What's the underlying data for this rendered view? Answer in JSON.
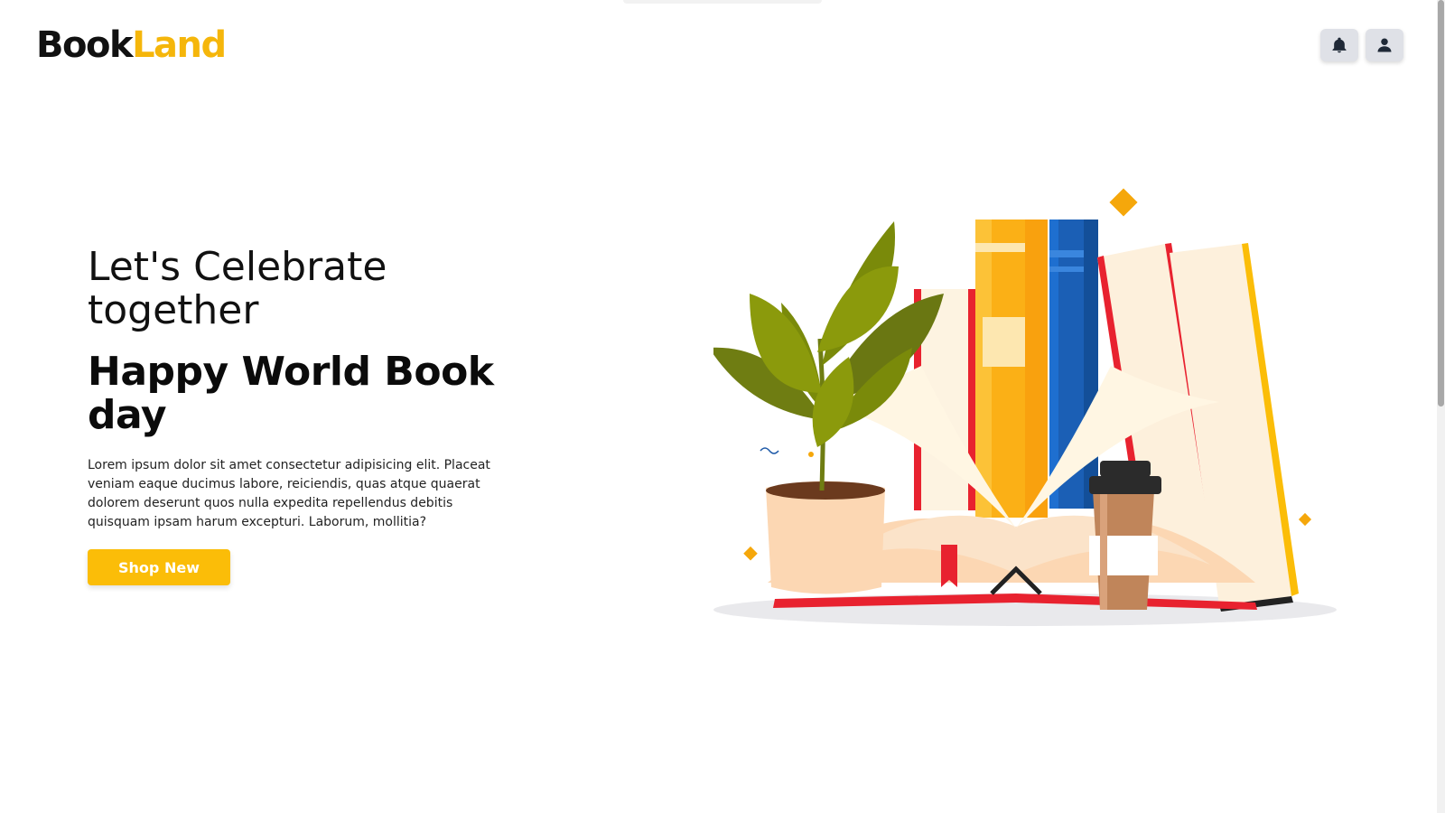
{
  "brand": {
    "part1": "Book",
    "part2": "Land",
    "colors": {
      "dark": "#111111",
      "accent": "#f5b60b"
    }
  },
  "header": {
    "notifications_icon": "bell-icon",
    "account_icon": "user-icon"
  },
  "hero": {
    "subtitle": "Let's Celebrate together",
    "title": "Happy World Book day",
    "body": "Lorem ipsum dolor sit amet consectetur adipisicing elit. Placeat veniam eaque ducimus labore, reiciendis, quas atque quaerat dolorem deserunt quos nulla expedita repellendus debitis quisquam ipsam harum excepturi. Laborum, mollitia?",
    "cta_label": "Shop New",
    "cta_color": "#fbbd08"
  },
  "illustration": {
    "subject": "books-plant-coffee-illustration"
  }
}
